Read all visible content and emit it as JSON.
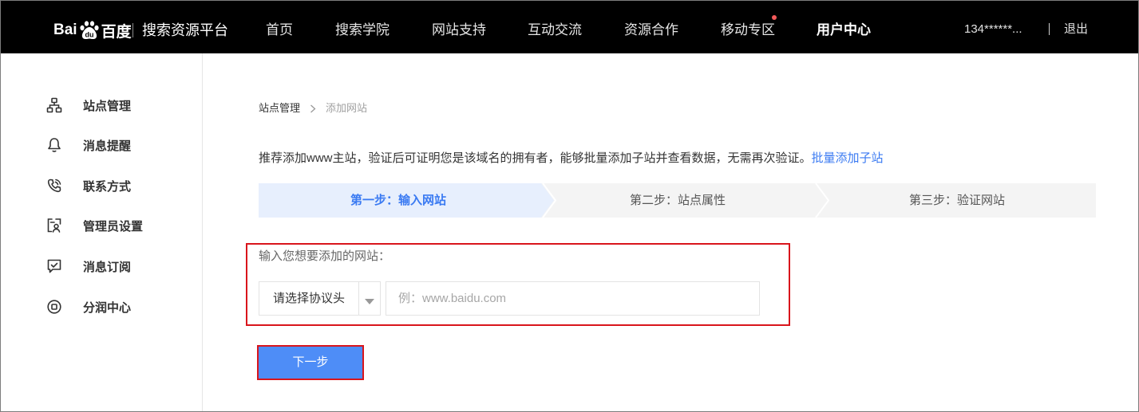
{
  "header": {
    "logo": {
      "text_left": "Bai",
      "paw_text": "du",
      "text_right": "百度",
      "icon": "baidu-paw-icon"
    },
    "platform_name": "搜索资源平台",
    "nav": [
      {
        "label": "首页",
        "active": false,
        "dot": false
      },
      {
        "label": "搜索学院",
        "active": false,
        "dot": false
      },
      {
        "label": "网站支持",
        "active": false,
        "dot": false
      },
      {
        "label": "互动交流",
        "active": false,
        "dot": false
      },
      {
        "label": "资源合作",
        "active": false,
        "dot": false
      },
      {
        "label": "移动专区",
        "active": false,
        "dot": true
      },
      {
        "label": "用户中心",
        "active": true,
        "dot": false
      }
    ],
    "user": {
      "account": "134******...",
      "logout": "退出"
    }
  },
  "sidebar": {
    "items": [
      {
        "label": "站点管理",
        "icon": "sitemap-icon"
      },
      {
        "label": "消息提醒",
        "icon": "bell-icon"
      },
      {
        "label": "联系方式",
        "icon": "phone-icon"
      },
      {
        "label": "管理员设置",
        "icon": "admin-icon"
      },
      {
        "label": "消息订阅",
        "icon": "subscribe-icon"
      },
      {
        "label": "分润中心",
        "icon": "revenue-share-icon"
      }
    ]
  },
  "main": {
    "breadcrumb": {
      "parent": "站点管理",
      "separator_icon": "chevron-right-icon",
      "current": "添加网站"
    },
    "notice": {
      "text": "推荐添加www主站，验证后可证明您是该域名的拥有者，能够批量添加子站并查看数据，无需再次验证。",
      "link": "批量添加子站"
    },
    "steps": [
      {
        "label": "第一步：输入网站",
        "active": true
      },
      {
        "label": "第二步：站点属性",
        "active": false
      },
      {
        "label": "第三步：验证网站",
        "active": false
      }
    ],
    "form": {
      "label": "输入您想要添加的网站：",
      "protocol_select": {
        "value": "请选择协议头",
        "icon": "caret-down-icon"
      },
      "url_input": {
        "value": "",
        "placeholder": "例：www.baidu.com"
      }
    },
    "next_button": {
      "label": "下一步"
    }
  },
  "colors": {
    "header_bg": "#000000",
    "accent_blue": "#4e8df7",
    "link_blue": "#3a7af2",
    "active_step_bg": "#e7effd",
    "highlight_red": "#d9151c",
    "notification_dot": "#f45a5a"
  }
}
